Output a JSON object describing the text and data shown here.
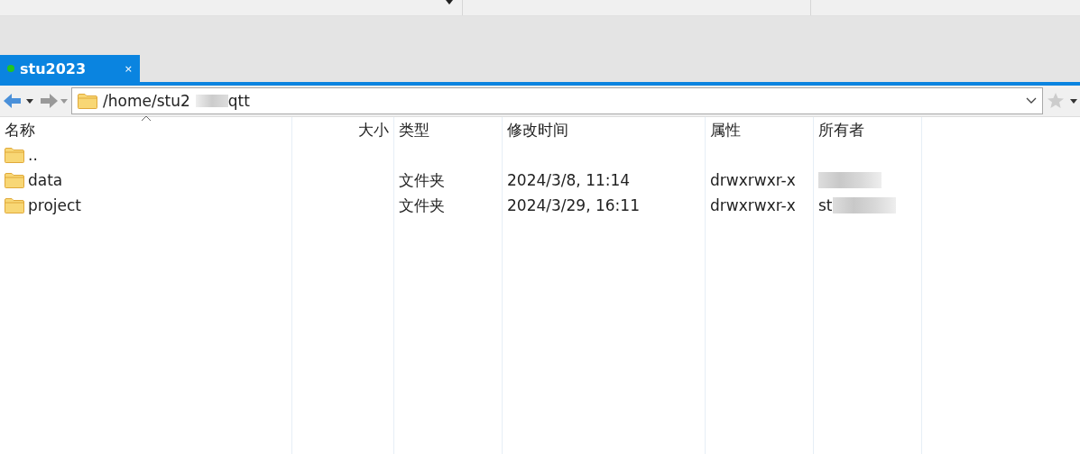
{
  "tabs": [
    {
      "label": "stu2023",
      "connected": true,
      "selected": true,
      "close": "×"
    }
  ],
  "address": {
    "path_start": "/home/stu2",
    "path_end": "qtt"
  },
  "table": {
    "columns": [
      {
        "label": "名称",
        "sorted": true
      },
      {
        "label": "大小",
        "sorted": false
      },
      {
        "label": "类型",
        "sorted": false
      },
      {
        "label": "修改时间",
        "sorted": false
      },
      {
        "label": "属性",
        "sorted": false
      },
      {
        "label": "所有者",
        "sorted": false
      }
    ],
    "rows": [
      {
        "name": ".."
      },
      {
        "name": "data",
        "type": "文件夹",
        "modified": "2024/3/8, 11:14",
        "attributes": "drwxrwxr-x",
        "owner_blurred": true
      },
      {
        "name": "project",
        "type": "文件夹",
        "modified": "2024/3/29, 16:11",
        "attributes": "drwxrwxr-x",
        "owner": "st",
        "owner_blurred": true
      }
    ]
  }
}
